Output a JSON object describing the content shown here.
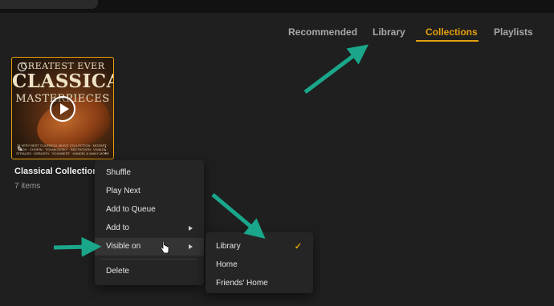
{
  "tabs": [
    {
      "label": "Recommended"
    },
    {
      "label": "Library"
    },
    {
      "label": "Collections"
    },
    {
      "label": "Playlists"
    }
  ],
  "active_tab": "Collections",
  "album_art": {
    "line1": "GREATEST EVER",
    "line2": "CLASSICAL",
    "line3": "MASTERPIECES",
    "line4": "75 VERY BEST CLASSICAL MUSIC COLLECTION · MOZART · BACH · CHOPIN · TCHAIKOVSKY · BEETHOVEN · VIVALDI · STRAUSS · DEBUSSY · SCHUBERT · HANDEL & MANY MORE"
  },
  "collection": {
    "title": "Classical Collections",
    "subtitle": "7 items"
  },
  "context_menu": {
    "items": [
      "Shuffle",
      "Play Next",
      "Add to Queue",
      "Add to",
      "Visible on",
      "Delete"
    ]
  },
  "visible_on_submenu": {
    "items": [
      "Library",
      "Home",
      "Friends' Home"
    ],
    "checked": "Library",
    "check_mark": "✓"
  },
  "colors": {
    "accent": "#e5a00d",
    "annotation_arrow": "#1aa68a",
    "background": "#1f1f1f"
  }
}
